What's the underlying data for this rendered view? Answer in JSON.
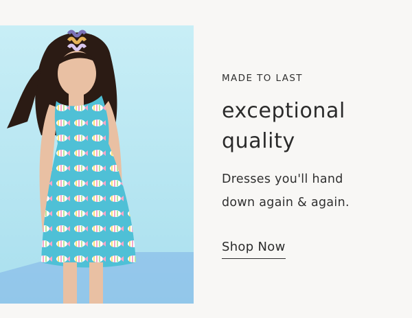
{
  "hero": {
    "eyebrow": "MADE TO LAST",
    "headline_line1": "exceptional",
    "headline_line2": "quality",
    "subcopy_line1": "Dresses you'll hand",
    "subcopy_line2": "down again & again.",
    "cta_label": "Shop Now"
  },
  "colors": {
    "page_bg": "#f8f7f5",
    "photo_bg": "#bfe8f2",
    "dress": "#4fc0d6",
    "text": "#2b2b2b"
  },
  "icons": {
    "hair_clips": "wavy-hair-clips",
    "dress_pattern": "striped-fish-print"
  }
}
